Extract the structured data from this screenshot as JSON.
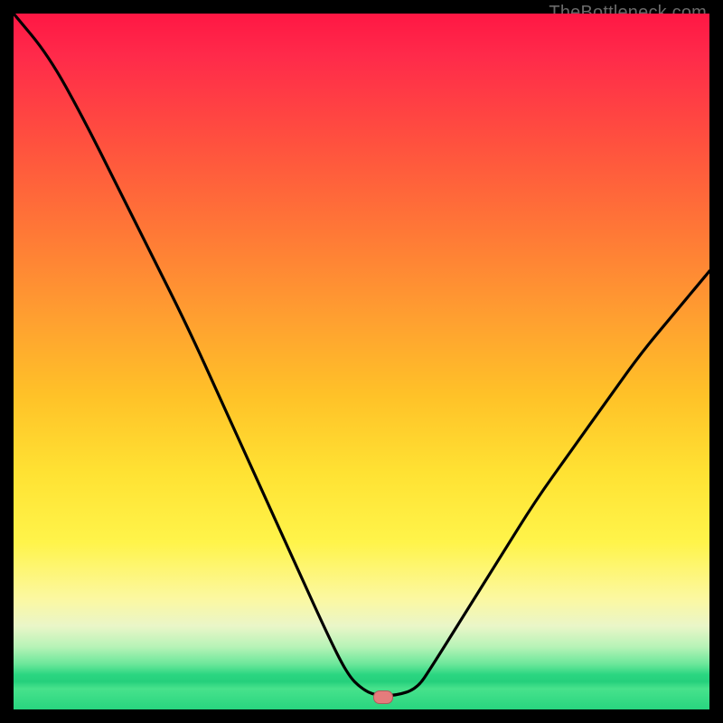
{
  "watermark": {
    "text": "TheBottleneck.com"
  },
  "colors": {
    "frame": "#000000",
    "curve": "#000000",
    "marker_fill": "#e47c7c",
    "marker_border": "rgba(0,0,0,0.25)"
  },
  "chart_data": {
    "type": "line",
    "title": "",
    "xlabel": "",
    "ylabel": "",
    "xlim": [
      0,
      100
    ],
    "ylim": [
      0,
      100
    ],
    "grid": false,
    "legend": false,
    "background_gradient": {
      "direction": "vertical",
      "stops": [
        {
          "pos": 0.0,
          "color": "#ff1744"
        },
        {
          "pos": 0.18,
          "color": "#ff4f3f"
        },
        {
          "pos": 0.44,
          "color": "#ffa030"
        },
        {
          "pos": 0.66,
          "color": "#ffe233"
        },
        {
          "pos": 0.84,
          "color": "#fcf8a0"
        },
        {
          "pos": 0.95,
          "color": "#2bd681"
        },
        {
          "pos": 1.0,
          "color": "#28d57f"
        }
      ]
    },
    "series": [
      {
        "name": "bottleneck-curve",
        "note": "V-shaped curve; y values approximate (no axis ticks in source)",
        "x": [
          0,
          5,
          10,
          15,
          20,
          25,
          30,
          35,
          40,
          45,
          48,
          50,
          52,
          55,
          58,
          60,
          65,
          70,
          75,
          80,
          85,
          90,
          95,
          100
        ],
        "y": [
          100,
          94,
          85,
          75,
          65,
          55,
          44,
          33,
          22,
          11,
          5,
          3,
          2,
          2,
          3,
          6,
          14,
          22,
          30,
          37,
          44,
          51,
          57,
          63
        ]
      }
    ],
    "marker": {
      "name": "current-point",
      "x": 53,
      "y": 2
    }
  }
}
